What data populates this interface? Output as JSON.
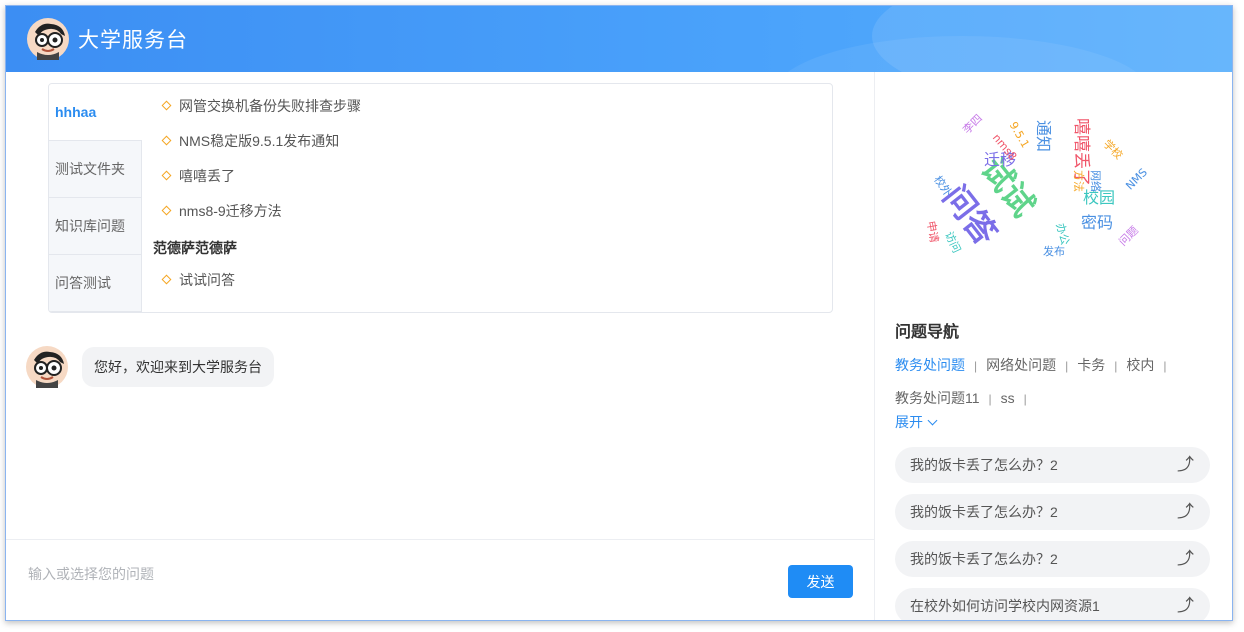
{
  "header": {
    "title": "大学服务台"
  },
  "knowledge": {
    "tabs": [
      "hhhaa",
      "测试文件夹",
      "知识库问题",
      "问答测试"
    ],
    "active_tab": 0,
    "items": [
      "网管交换机备份失败排查步骤",
      "NMS稳定版9.5.1发布通知",
      "嘻嘻丢了",
      "nms8-9迁移方法"
    ],
    "group_title": "范德萨范德萨",
    "group_items": [
      "试试问答"
    ]
  },
  "chat": {
    "welcome": "您好，欢迎来到大学服务台"
  },
  "input": {
    "placeholder": "输入或选择您的问题",
    "send_label": "发送"
  },
  "word_cloud": {
    "words": [
      "问答",
      "试试",
      "嘻嘻丢了",
      "通知",
      "迁移",
      "校园",
      "密码",
      "nms8",
      "9.5.1",
      "学校",
      "李四",
      "校外",
      "申请",
      "访问",
      "办公",
      "发布",
      "问题",
      "NMS",
      "网络",
      "方法"
    ],
    "colors": [
      "#7b6ee8",
      "#5fd48a",
      "#f0566a",
      "#4a90e2",
      "#f5a623",
      "#c77be8",
      "#3cc7c0"
    ]
  },
  "nav": {
    "title": "问题导航",
    "links": [
      "教务处问题",
      "网络处问题",
      "卡务",
      "校内",
      "教务处问题11",
      "ss"
    ],
    "active_link": 0,
    "expand_label": "展开",
    "questions": [
      "我的饭卡丢了怎么办？2",
      "我的饭卡丢了怎么办？2",
      "我的饭卡丢了怎么办？2",
      "在校外如何访问学校内网资源1"
    ]
  }
}
